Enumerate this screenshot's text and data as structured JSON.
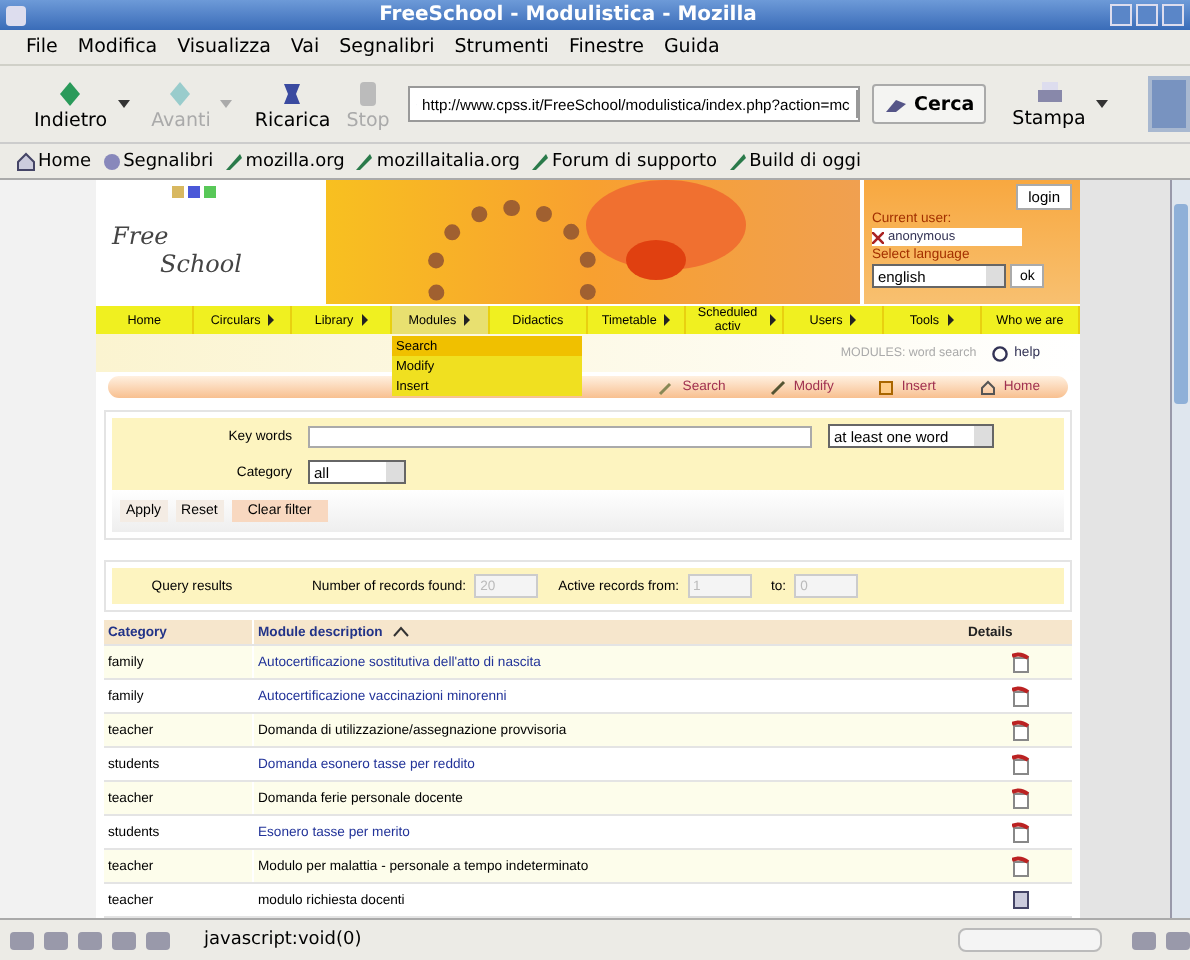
{
  "window": {
    "title": "FreeSchool - Modulistica - Mozilla"
  },
  "menu_bar": [
    "File",
    "Modifica",
    "Visualizza",
    "Vai",
    "Segnalibri",
    "Strumenti",
    "Finestre",
    "Guida"
  ],
  "toolbar": {
    "buttons": [
      {
        "label": "Indietro",
        "kind": "back",
        "disabled": false,
        "dropdown": true
      },
      {
        "label": "Avanti",
        "kind": "forward",
        "disabled": true,
        "dropdown": true
      },
      {
        "label": "Ricarica",
        "kind": "reload",
        "disabled": false,
        "dropdown": false
      },
      {
        "label": "Stop",
        "kind": "stop",
        "disabled": true,
        "dropdown": false
      }
    ],
    "url": "http://www.cpss.it/FreeSchool/modulistica/index.php?action=mc",
    "search_button": "Cerca",
    "print_button": "Stampa"
  },
  "bookmarks": [
    {
      "label": "Home",
      "kind": "home"
    },
    {
      "label": "Segnalibri",
      "kind": "bookmarks"
    },
    {
      "label": "mozilla.org",
      "kind": "link"
    },
    {
      "label": "mozillaitalia.org",
      "kind": "link"
    },
    {
      "label": "Forum di supporto",
      "kind": "link"
    },
    {
      "label": "Build di oggi",
      "kind": "link"
    }
  ],
  "header": {
    "logo_lines": [
      "Free",
      "School"
    ],
    "login_button": "login",
    "current_user_label": "Current user:",
    "current_user": "anonymous",
    "language_label": "Select language",
    "language": "english",
    "ok_button": "ok"
  },
  "nav": [
    {
      "label": "Home",
      "submenu": false,
      "selected": false
    },
    {
      "label": "Circulars",
      "submenu": true,
      "selected": false
    },
    {
      "label": "Library",
      "submenu": true,
      "selected": false
    },
    {
      "label": "Modules",
      "submenu": true,
      "selected": true
    },
    {
      "label": "Didactics",
      "submenu": false,
      "selected": false
    },
    {
      "label": "Timetable",
      "submenu": true,
      "selected": false
    },
    {
      "label": "Scheduled activ",
      "submenu": true,
      "selected": false
    },
    {
      "label": "Users",
      "submenu": true,
      "selected": false
    },
    {
      "label": "Tools",
      "submenu": true,
      "selected": false
    },
    {
      "label": "Who we are",
      "submenu": false,
      "selected": false
    }
  ],
  "dropdown": [
    {
      "label": "Search",
      "selected": true
    },
    {
      "label": "Modify",
      "selected": false
    },
    {
      "label": "Insert",
      "selected": false
    }
  ],
  "section": {
    "title": "MODULES: word search",
    "help": "help"
  },
  "actions": [
    {
      "label": "Search",
      "kind": "search"
    },
    {
      "label": "Modify",
      "kind": "modify"
    },
    {
      "label": "Insert",
      "kind": "insert"
    },
    {
      "label": "Home",
      "kind": "home"
    }
  ],
  "search_form": {
    "keywords_label": "Key words",
    "match_mode": "at least one word",
    "category_label": "Category",
    "category": "all",
    "buttons": [
      "Apply",
      "Reset",
      "Clear filter"
    ]
  },
  "query_results": {
    "title": "Query results",
    "found_label": "Number of records found:",
    "found": "20",
    "from_label": "Active records from:",
    "from": "1",
    "to_label": "to:",
    "to": "0"
  },
  "table": {
    "columns": [
      "Category",
      "Module description",
      "Details"
    ],
    "rows": [
      {
        "category": "family",
        "description": "Autocertificazione sostitutiva dell'atto di nascita",
        "linked": true,
        "kind": "pdf"
      },
      {
        "category": "family",
        "description": "Autocertificazione vaccinazioni minorenni",
        "linked": true,
        "kind": "pdf"
      },
      {
        "category": "teacher",
        "description": "Domanda di utilizzazione/assegnazione provvisoria",
        "linked": false,
        "kind": "pdf"
      },
      {
        "category": "students",
        "description": "Domanda esonero tasse per reddito",
        "linked": true,
        "kind": "pdf"
      },
      {
        "category": "teacher",
        "description": "Domanda ferie personale docente",
        "linked": false,
        "kind": "pdf"
      },
      {
        "category": "students",
        "description": "Esonero tasse per merito",
        "linked": true,
        "kind": "pdf"
      },
      {
        "category": "teacher",
        "description": "Modulo per malattia - personale a tempo indeterminato",
        "linked": false,
        "kind": "pdf"
      },
      {
        "category": "teacher",
        "description": "modulo richiesta docenti",
        "linked": false,
        "kind": "doc"
      }
    ]
  },
  "status_bar": {
    "text": "javascript:void(0)"
  }
}
